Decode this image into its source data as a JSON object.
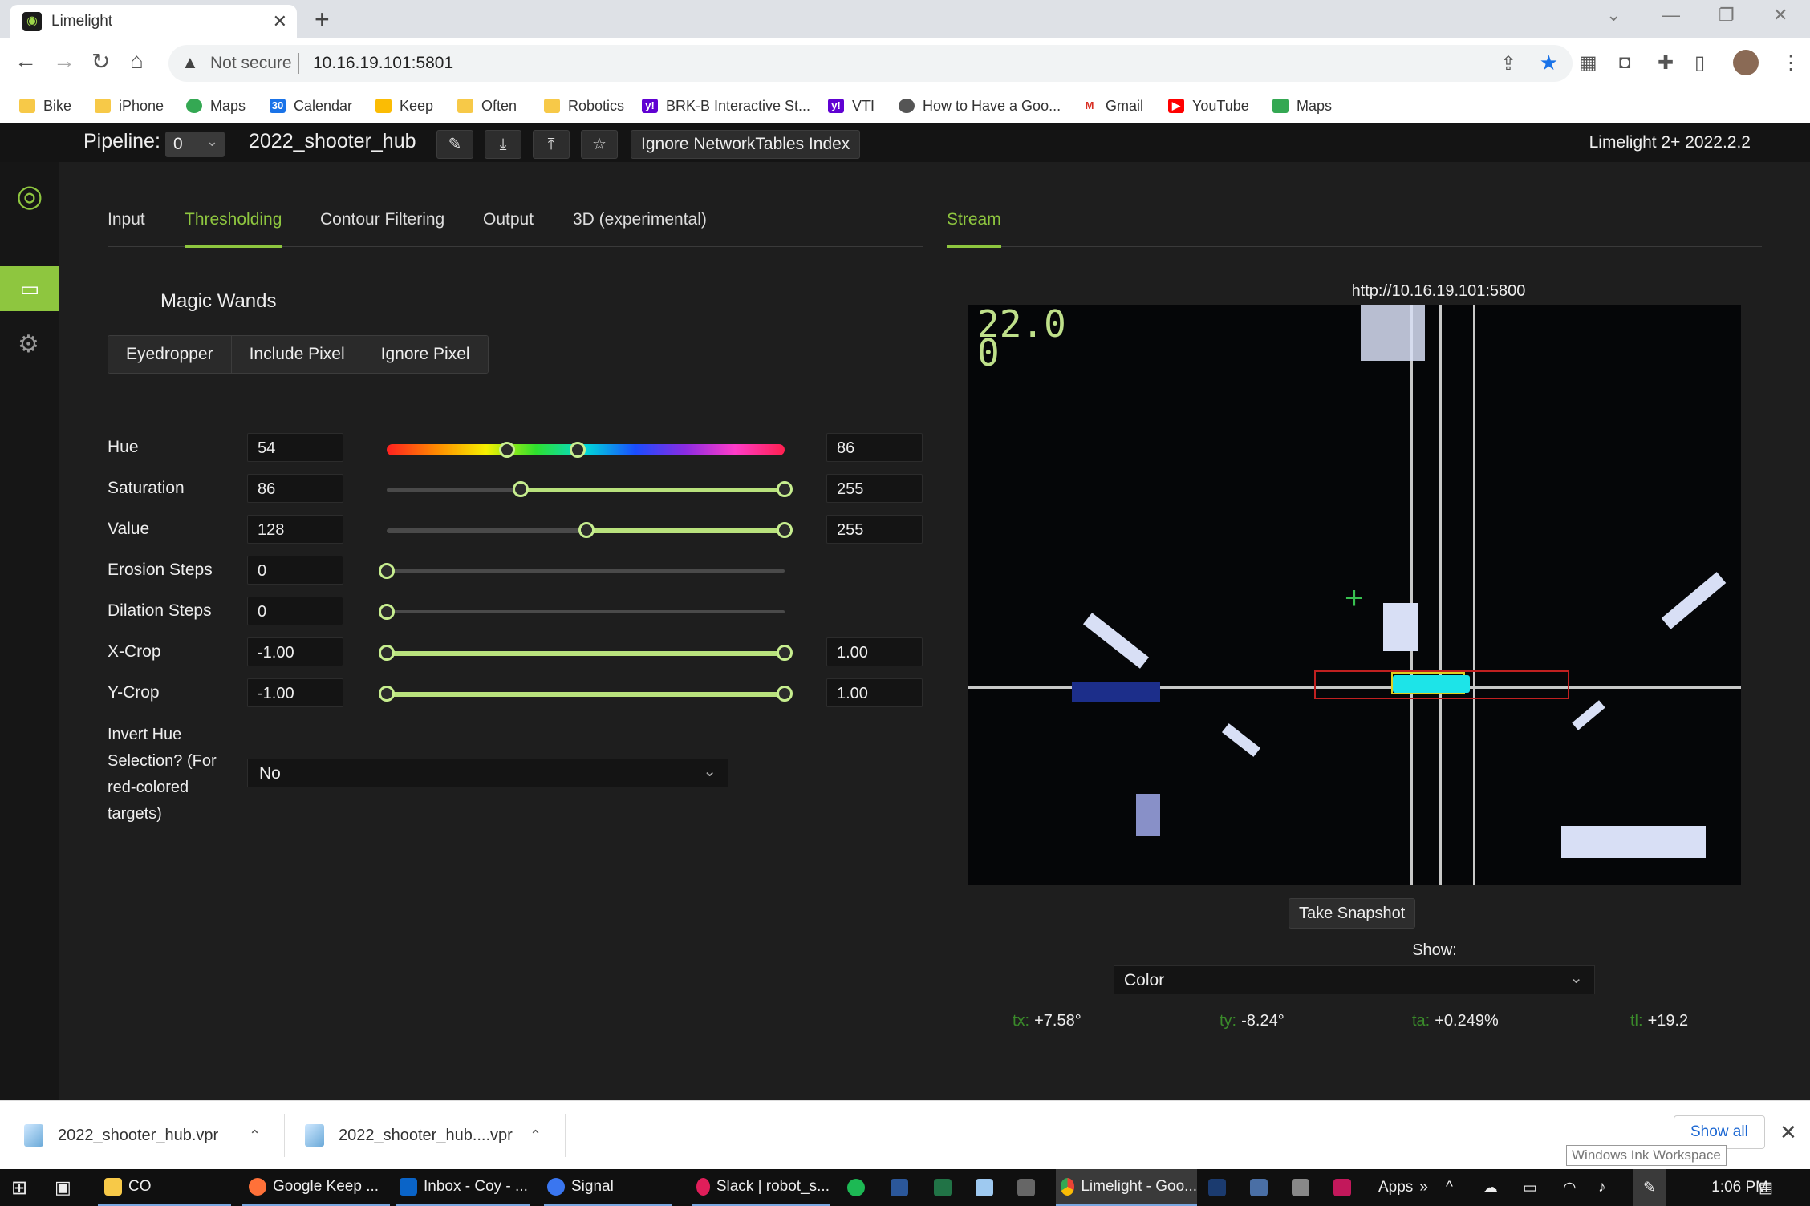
{
  "browser": {
    "tab_title": "Limelight",
    "security_label": "Not secure",
    "url": "10.16.19.101:5801",
    "bookmarks": [
      "Bike",
      "iPhone",
      "Maps",
      "Calendar",
      "Keep",
      "Often",
      "Robotics",
      "BRK-B Interactive St...",
      "VTI",
      "How to Have a Goo...",
      "Gmail",
      "YouTube",
      "Maps"
    ]
  },
  "app": {
    "pipeline_label": "Pipeline:",
    "pipeline_index": "0",
    "pipeline_name": "2022_shooter_hub",
    "ignore_nt_label": "Ignore NetworkTables Index",
    "version": "Limelight 2+ 2022.2.2",
    "tabs": [
      "Input",
      "Thresholding",
      "Contour Filtering",
      "Output",
      "3D (experimental)"
    ],
    "active_tab": "Thresholding",
    "stream_tab": "Stream"
  },
  "magic_wands": {
    "title": "Magic Wands",
    "buttons": [
      "Eyedropper",
      "Include Pixel",
      "Ignore Pixel"
    ]
  },
  "thresholds": {
    "hue": {
      "label": "Hue",
      "min": "54",
      "max": "86",
      "range": [
        0,
        179
      ],
      "low": 54,
      "high": 86
    },
    "saturation": {
      "label": "Saturation",
      "min": "86",
      "max": "255",
      "range": [
        0,
        255
      ],
      "low": 86,
      "high": 255
    },
    "value": {
      "label": "Value",
      "min": "128",
      "max": "255",
      "range": [
        0,
        255
      ],
      "low": 128,
      "high": 255
    },
    "erosion": {
      "label": "Erosion Steps",
      "value": "0",
      "range": [
        0,
        3
      ],
      "level": 0
    },
    "dilation": {
      "label": "Dilation Steps",
      "value": "0",
      "range": [
        0,
        3
      ],
      "level": 0
    },
    "xcrop": {
      "label": "X-Crop",
      "min": "-1.00",
      "max": "1.00",
      "range": [
        -1,
        1
      ],
      "low": -1,
      "high": 1
    },
    "ycrop": {
      "label": "Y-Crop",
      "min": "-1.00",
      "max": "1.00",
      "range": [
        -1,
        1
      ],
      "low": -1,
      "high": 1
    },
    "invert_label": "Invert Hue Selection? (For red-colored targets)",
    "invert_value": "No"
  },
  "stream": {
    "url": "http://10.16.19.101:5800",
    "osd_line1": "22.0",
    "osd_line2": "0",
    "snapshot_label": "Take Snapshot",
    "show_label": "Show:",
    "show_value": "Color",
    "readouts": [
      {
        "key": "tx:",
        "value": "+7.58°"
      },
      {
        "key": "ty:",
        "value": "-8.24°"
      },
      {
        "key": "ta:",
        "value": "+0.249%"
      },
      {
        "key": "tl:",
        "value": "+19.2"
      }
    ]
  },
  "downloads": {
    "items": [
      "2022_shooter_hub.vpr",
      "2022_shooter_hub....vpr"
    ],
    "show_all": "Show all",
    "ink_tooltip": "Windows Ink Workspace"
  },
  "taskbar": {
    "items": [
      "CO",
      "Google Keep ...",
      "Inbox - Coy - ...",
      "Signal",
      "Slack | robot_s...",
      "Limelight - Goo..."
    ],
    "apps_label": "Apps",
    "clock": "1:06 PM"
  },
  "colors": {
    "accent": "#8ec63f",
    "slider_fill": "#b9e27d"
  }
}
